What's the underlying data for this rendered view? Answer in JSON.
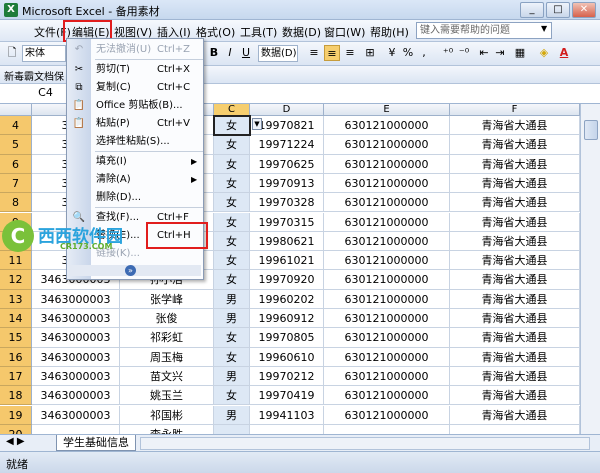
{
  "window": {
    "title": "Microsoft Excel - 备用素材",
    "minimize": "_",
    "restore": "□",
    "close": "✕",
    "app_icon": "X"
  },
  "menubar": {
    "items": [
      "文件(F)",
      "编辑(E)",
      "视图(V)",
      "插入(I)",
      "格式(O)",
      "工具(T)",
      "数据(D)",
      "窗口(W)",
      "帮助(H)"
    ],
    "help_placeholder": "键入需要帮助的问题"
  },
  "toolbar": {
    "font_name": "宋体",
    "bold": "B",
    "italic": "I",
    "underline": "U",
    "number_format": "数据(D)",
    "percent": "%",
    "comma": ",",
    "new_doc_label": "新毒霸文档保"
  },
  "formula_bar": {
    "cell_ref": "C4"
  },
  "grid": {
    "columns": [
      {
        "id": "A",
        "label": ""
      },
      {
        "id": "B",
        "label": ""
      },
      {
        "id": "C",
        "label": "C"
      },
      {
        "id": "D",
        "label": "D"
      },
      {
        "id": "E",
        "label": "E"
      },
      {
        "id": "F",
        "label": "F"
      }
    ],
    "rows": [
      {
        "num": "4",
        "a": "3463",
        "b": "",
        "c": "女",
        "d": "19970821",
        "e": "630121000000",
        "f": "青海省大通县"
      },
      {
        "num": "5",
        "a": "3463",
        "b": "",
        "c": "女",
        "d": "19971224",
        "e": "630121000000",
        "f": "青海省大通县"
      },
      {
        "num": "6",
        "a": "3463",
        "b": "",
        "c": "女",
        "d": "19970625",
        "e": "630121000000",
        "f": "青海省大通县"
      },
      {
        "num": "7",
        "a": "3463",
        "b": "",
        "c": "女",
        "d": "19970913",
        "e": "630121000000",
        "f": "青海省大通县"
      },
      {
        "num": "8",
        "a": "3463",
        "b": "",
        "c": "女",
        "d": "19970328",
        "e": "630121000000",
        "f": "青海省大通县"
      },
      {
        "num": "9",
        "a": "",
        "b": "",
        "c": "女",
        "d": "19970315",
        "e": "630121000000",
        "f": "青海省大通县"
      },
      {
        "num": "10",
        "a": "",
        "b": "",
        "c": "女",
        "d": "19980621",
        "e": "630121000000",
        "f": "青海省大通县"
      },
      {
        "num": "11",
        "a": "3463",
        "b": "",
        "c": "女",
        "d": "19961021",
        "e": "630121000000",
        "f": "青海省大通县"
      },
      {
        "num": "12",
        "a": "3463000003",
        "b": "孙小洁",
        "c": "女",
        "d": "19970920",
        "e": "630121000000",
        "f": "青海省大通县"
      },
      {
        "num": "13",
        "a": "3463000003",
        "b": "张学峰",
        "c": "男",
        "d": "19960202",
        "e": "630121000000",
        "f": "青海省大通县"
      },
      {
        "num": "14",
        "a": "3463000003",
        "b": "张俊",
        "c": "男",
        "d": "19960912",
        "e": "630121000000",
        "f": "青海省大通县"
      },
      {
        "num": "15",
        "a": "3463000003",
        "b": "祁彩虹",
        "c": "女",
        "d": "19970805",
        "e": "630121000000",
        "f": "青海省大通县"
      },
      {
        "num": "16",
        "a": "3463000003",
        "b": "周玉梅",
        "c": "女",
        "d": "19960610",
        "e": "630121000000",
        "f": "青海省大通县"
      },
      {
        "num": "17",
        "a": "3463000003",
        "b": "苗文兴",
        "c": "男",
        "d": "19970212",
        "e": "630121000000",
        "f": "青海省大通县"
      },
      {
        "num": "18",
        "a": "3463000003",
        "b": "姚玉兰",
        "c": "女",
        "d": "19970419",
        "e": "630121000000",
        "f": "青海省大通县"
      },
      {
        "num": "19",
        "a": "3463000003",
        "b": "祁国彬",
        "c": "男",
        "d": "19941103",
        "e": "630121000000",
        "f": "青海省大通县"
      },
      {
        "num": "20",
        "a": "",
        "b": "李永胜",
        "c": "",
        "d": "",
        "e": "",
        "f": ""
      }
    ]
  },
  "edit_menu": {
    "items": [
      {
        "label": "无法撤消(U)",
        "shortcut": "Ctrl+Z",
        "icon": "↶",
        "disabled": true
      },
      {
        "label": "剪切(T)",
        "shortcut": "Ctrl+X",
        "icon": "✂",
        "disabled": false
      },
      {
        "label": "复制(C)",
        "shortcut": "Ctrl+C",
        "icon": "⧉",
        "disabled": false
      },
      {
        "label": "Office 剪贴板(B)...",
        "shortcut": "",
        "icon": "📋",
        "disabled": false
      },
      {
        "label": "粘贴(P)",
        "shortcut": "Ctrl+V",
        "icon": "📋",
        "disabled": false
      },
      {
        "label": "选择性粘贴(S)...",
        "shortcut": "",
        "icon": "",
        "disabled": false
      },
      {
        "label": "填充(I)",
        "shortcut": "",
        "icon": "",
        "disabled": false
      },
      {
        "label": "清除(A)",
        "shortcut": "",
        "icon": "",
        "disabled": false
      },
      {
        "label": "删除(D)...",
        "shortcut": "",
        "icon": "",
        "disabled": false
      },
      {
        "label": "查找(F)...",
        "shortcut": "Ctrl+F",
        "icon": "🔍",
        "disabled": false
      },
      {
        "label": "替换(E)...",
        "shortcut": "Ctrl+H",
        "icon": "",
        "disabled": false
      },
      {
        "label": "链接(K)...",
        "shortcut": "",
        "icon": "",
        "disabled": true
      }
    ],
    "expand": "»"
  },
  "sheet": {
    "tab_label": "学生基础信息",
    "nav": "◀ ▶"
  },
  "status": {
    "text": "就绪"
  },
  "watermark": {
    "logo_letter": "C",
    "name": "西西软件园",
    "url": "CR173.COM"
  },
  "colors": {
    "highlight_red": "#e11d1d",
    "row_header": "#f5c86c",
    "menu_hover": "#c8dcf3"
  }
}
